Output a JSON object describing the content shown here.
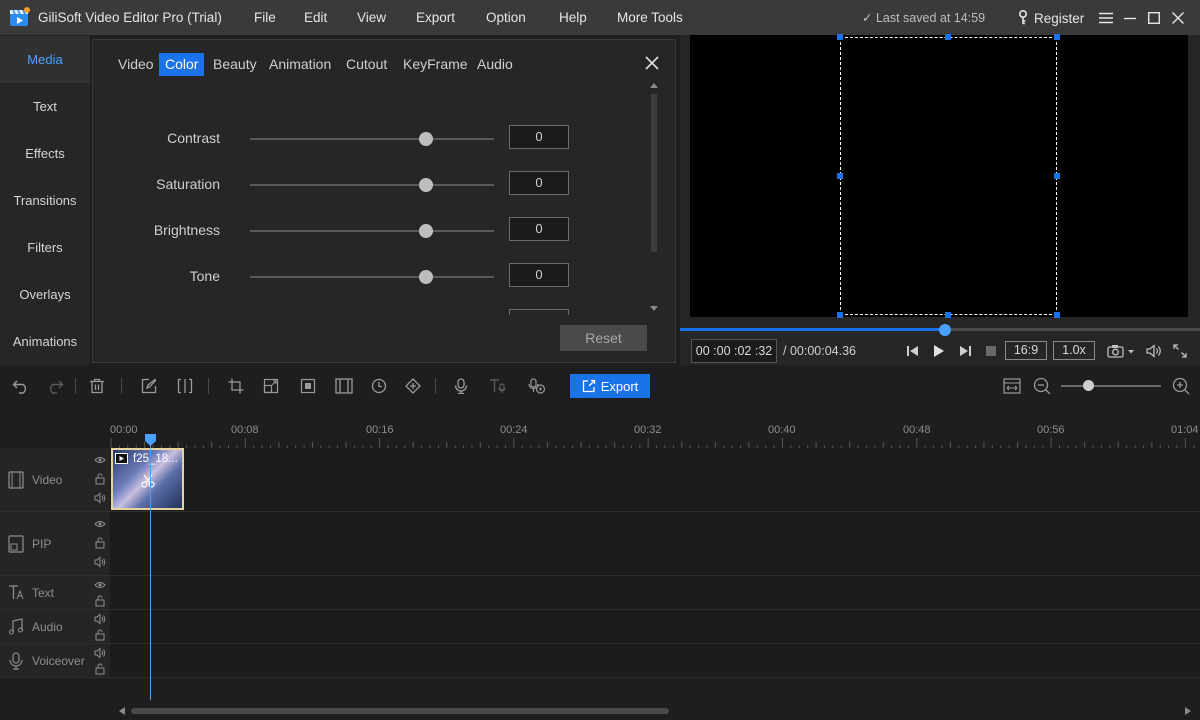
{
  "app": {
    "title": "GiliSoft Video Editor Pro (Trial)",
    "menu": [
      "File",
      "Edit",
      "View",
      "Export",
      "Option",
      "Help",
      "More Tools"
    ],
    "saved_status": "Last saved at 14:59",
    "register_label": "Register"
  },
  "leftnav": {
    "items": [
      "Media",
      "Text",
      "Effects",
      "Transitions",
      "Filters",
      "Overlays",
      "Animations"
    ],
    "active": "Media"
  },
  "panel": {
    "tabs": [
      "Video",
      "Color",
      "Beauty",
      "Animation",
      "Cutout",
      "KeyFrame",
      "Audio"
    ],
    "active_tab": "Color",
    "sliders": [
      {
        "label": "Contrast",
        "value": "0",
        "position": 0.72
      },
      {
        "label": "Saturation",
        "value": "0",
        "position": 0.72
      },
      {
        "label": "Brightness",
        "value": "0",
        "position": 0.72
      },
      {
        "label": "Tone",
        "value": "0",
        "position": 0.72
      }
    ],
    "reset_label": "Reset"
  },
  "preview": {
    "time_current": "00 :00 :02 :32",
    "time_total": "/ 00:00:04.36",
    "progress": 0.51,
    "aspect": "16:9",
    "speed": "1.0x"
  },
  "toolbar": {
    "export_label": "Export",
    "zoom_level": 0.27
  },
  "timeline": {
    "ruler_labels": [
      "00:00",
      "00:08",
      "00:16",
      "00:24",
      "00:32",
      "00:40",
      "00:48",
      "00:56",
      "01:04"
    ],
    "tracks": [
      "Video",
      "PIP",
      "Text",
      "Audio",
      "Voiceover"
    ],
    "clip": {
      "name": "f25_18..."
    }
  },
  "colors": {
    "accent": "#1a73e8",
    "active_tab_text": "#4aa0ff"
  }
}
